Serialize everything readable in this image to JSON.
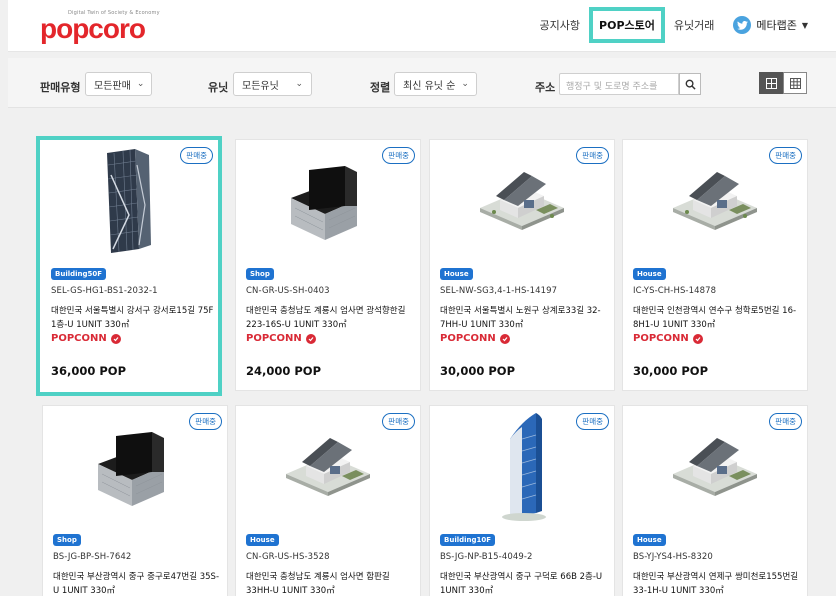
{
  "header": {
    "logo_tagline": "Digital Twin of Society & Economy",
    "logo_text": "popcoro",
    "nav": [
      {
        "label": "공지사항"
      },
      {
        "label": "POP스토어"
      },
      {
        "label": "유닛거래"
      }
    ],
    "user_name": "메타랩존",
    "accent_color": "#4fd1c5",
    "brand_color": "#e3262b"
  },
  "filters": {
    "sale_type_label": "판매유형",
    "sale_type_value": "모든판매",
    "unit_label": "유닛",
    "unit_value": "모든유닛",
    "sort_label": "정렬",
    "sort_value": "최신 유닛 순",
    "address_label": "주소",
    "address_placeholder": "행정구 및 도로명 주소를",
    "view_modes": [
      "large-grid-icon",
      "small-grid-icon"
    ]
  },
  "cards": [
    {
      "status": "판매중",
      "type": "Building50F",
      "code": "SEL-GS-HG1-BS1-2032-1",
      "desc": "대한민국 서울특별시 강서구 강서로15길 75F 1층-U 1UNIT 330㎡",
      "brand": "POPCONN",
      "price": "36,000 POP",
      "image": "tower-glass",
      "selected": true
    },
    {
      "status": "판매중",
      "type": "Shop",
      "code": "CN-GR-US-SH-0403",
      "desc": "대한민국 충청남도 계룡시 엄사면 광석향한길 223-16S-U 1UNIT 330㎡",
      "brand": "POPCONN",
      "price": "24,000 POP",
      "image": "shop-block"
    },
    {
      "status": "판매중",
      "type": "House",
      "code": "SEL-NW-SG3,4-1-HS-14197",
      "desc": "대한민국 서울특별시 노원구 상계로33길 32-7HH-U 1UNIT 330㎡",
      "brand": "POPCONN",
      "price": "30,000 POP",
      "image": "house"
    },
    {
      "status": "판매중",
      "type": "House",
      "code": "IC-YS-CH-HS-14878",
      "desc": "대한민국 인천광역시 연수구 청학로5번길 16-8H1-U 1UNIT 330㎡",
      "brand": "POPCONN",
      "price": "30,000 POP",
      "image": "house"
    },
    {
      "status": "판매중",
      "type": "Shop",
      "code": "BS-JG-BP-SH-7642",
      "desc": "대한민국 부산광역시 중구 중구로47번길 35S-U 1UNIT 330㎡",
      "brand": "",
      "price": "",
      "image": "shop-block"
    },
    {
      "status": "판매중",
      "type": "House",
      "code": "CN-GR-US-HS-3528",
      "desc": "대한민국 충청남도 계룡시 엄사면 함판길 33HH-U 1UNIT 330㎡",
      "brand": "",
      "price": "",
      "image": "house"
    },
    {
      "status": "판매중",
      "type": "Building10F",
      "code": "BS-JG-NP-B15-4049-2",
      "desc": "대한민국 부산광역시 중구 구덕로 66B 2층-U 1UNIT 330㎡",
      "brand": "",
      "price": "",
      "image": "tower-blue"
    },
    {
      "status": "판매중",
      "type": "House",
      "code": "BS-YJ-YS4-HS-8320",
      "desc": "대한민국 부산광역시 연제구 쌍미천로155번길 33-1H-U 1UNIT 330㎡",
      "brand": "",
      "price": "",
      "image": "house"
    }
  ]
}
